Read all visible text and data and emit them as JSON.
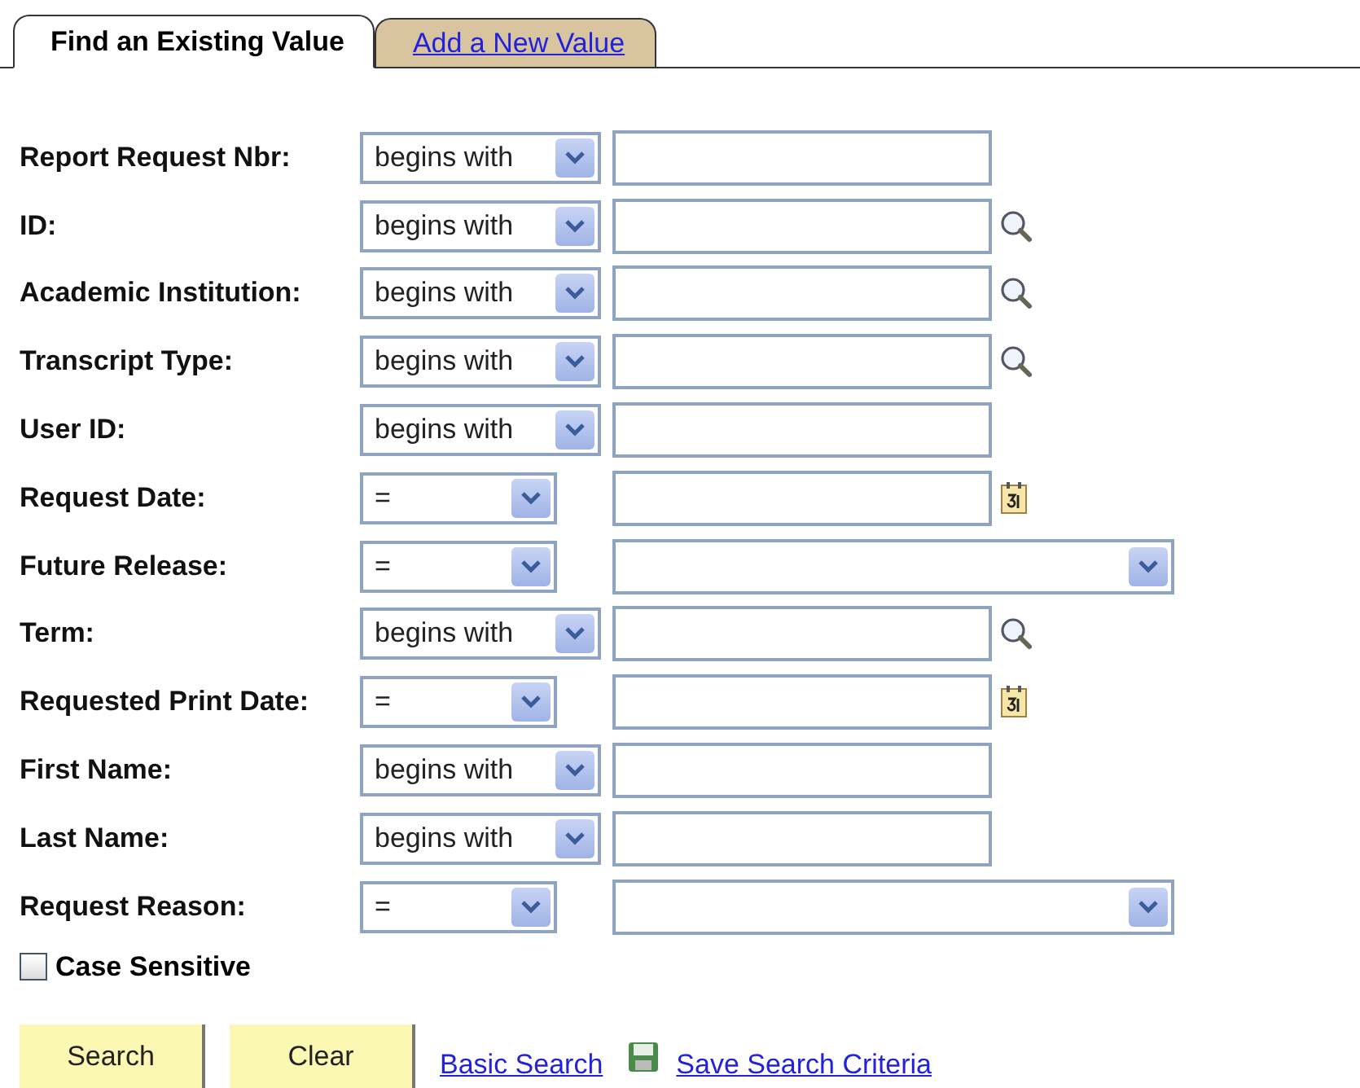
{
  "tabs": [
    {
      "label": "Find an Existing Value",
      "selected": true
    },
    {
      "label": "Add a New Value",
      "selected": false
    }
  ],
  "fields": [
    {
      "label": "Report Request Nbr:",
      "operator": "begins with",
      "kind": "text"
    },
    {
      "label": "ID:",
      "operator": "begins with",
      "kind": "lookup"
    },
    {
      "label": "Academic Institution:",
      "operator": "begins with",
      "kind": "lookup"
    },
    {
      "label": "Transcript Type:",
      "operator": "begins with",
      "kind": "lookup"
    },
    {
      "label": "User ID:",
      "operator": "begins with",
      "kind": "text"
    },
    {
      "label": "Request Date:",
      "operator": "=",
      "kind": "date"
    },
    {
      "label": "Future Release:",
      "operator": "=",
      "kind": "select"
    },
    {
      "label": "Term:",
      "operator": "begins with",
      "kind": "lookup"
    },
    {
      "label": "Requested Print Date:",
      "operator": "=",
      "kind": "date"
    },
    {
      "label": "First Name:",
      "operator": "begins with",
      "kind": "text"
    },
    {
      "label": "Last Name:",
      "operator": "begins with",
      "kind": "text"
    },
    {
      "label": "Request Reason:",
      "operator": "=",
      "kind": "select"
    }
  ],
  "case_sensitive": {
    "label": "Case Sensitive",
    "checked": false
  },
  "buttons": [
    "Search",
    "Clear"
  ],
  "links": [
    {
      "label": "Basic Search",
      "kind": "plain"
    },
    {
      "label": "Save Search Criteria",
      "kind": "save"
    }
  ]
}
